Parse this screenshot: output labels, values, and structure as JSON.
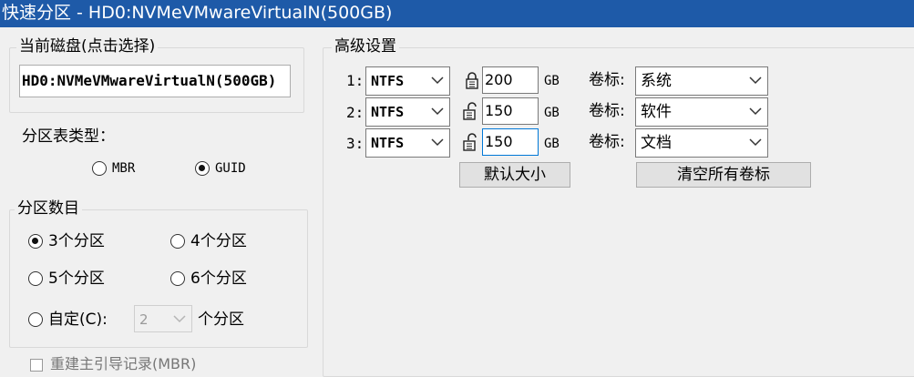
{
  "window": {
    "title": "快速分区 - HD0:NVMeVMwareVirtualN(500GB)"
  },
  "current_disk": {
    "label": "当前磁盘(点击选择)",
    "value": "HD0:NVMeVMwareVirtualN(500GB)"
  },
  "partition_table": {
    "label": "分区表类型：",
    "mbr": "MBR",
    "guid": "GUID",
    "selected": "GUID"
  },
  "partition_count": {
    "label": "分区数目",
    "opt3": "3个分区",
    "opt4": "4个分区",
    "opt5": "5个分区",
    "opt6": "6个分区",
    "custom": "自定(C):",
    "custom_value": "2",
    "custom_suffix": "个分区",
    "selected": "3个分区"
  },
  "bottom_option": {
    "label": "重建主引导记录(MBR)"
  },
  "advanced": {
    "label": "高级设置",
    "volume_label_caption": "卷标:",
    "unit": "GB",
    "rows": [
      {
        "index": "1:",
        "fs": "NTFS",
        "size": "200",
        "locked": true,
        "volume": "系统"
      },
      {
        "index": "2:",
        "fs": "NTFS",
        "size": "150",
        "locked": false,
        "volume": "软件"
      },
      {
        "index": "3:",
        "fs": "NTFS",
        "size": "150",
        "locked": false,
        "volume": "文档"
      }
    ],
    "default_size_button": "默认大小",
    "clear_labels_button": "清空所有卷标"
  }
}
